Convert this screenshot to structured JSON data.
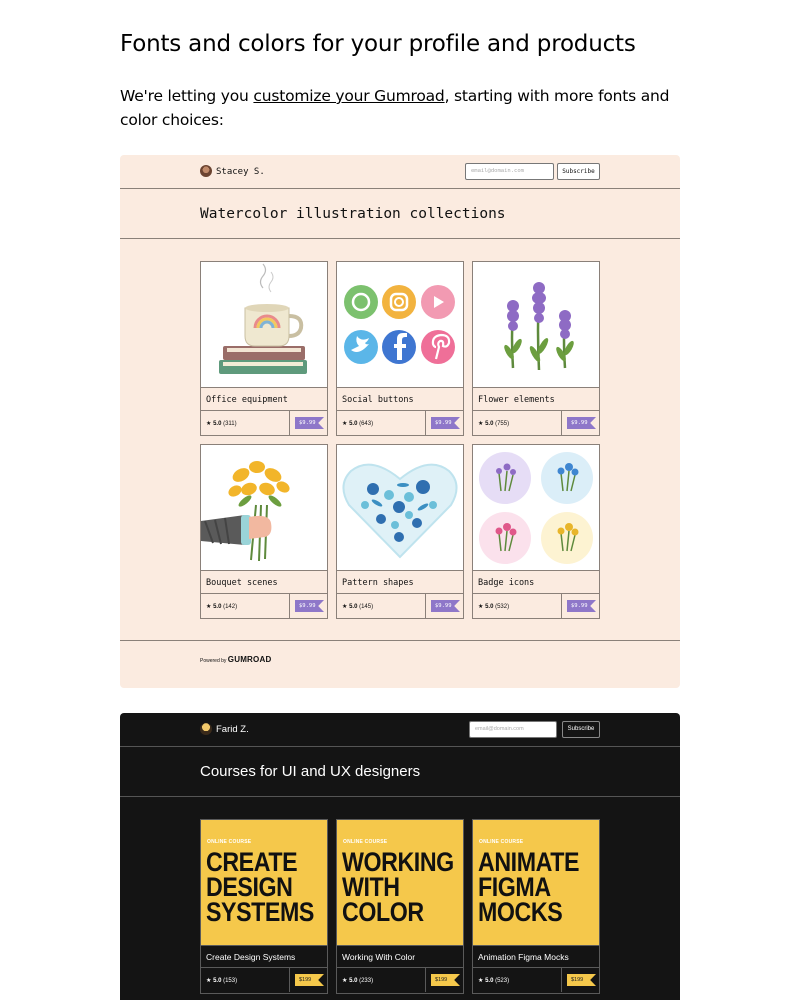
{
  "article": {
    "title": "Fonts and colors for your profile and products",
    "intro_before": "We're letting you ",
    "intro_link": "customize your Gumroad",
    "intro_after": ", starting with more fonts and color choices:"
  },
  "light_profile": {
    "creator_name": "Stacey S.",
    "email_placeholder": "email@domain.com",
    "subscribe_label": "Subscribe",
    "page_title": "Watercolor illustration collections",
    "products": [
      {
        "name": "Office equipment",
        "rating": "5.0",
        "count": "(311)",
        "price": "$9.99",
        "icon": "coffee-cup-books-icon"
      },
      {
        "name": "Social buttons",
        "rating": "5.0",
        "count": "(643)",
        "price": "$9.99",
        "icon": "social-buttons-icon"
      },
      {
        "name": "Flower elements",
        "rating": "5.0",
        "count": "(755)",
        "price": "$9.99",
        "icon": "lavender-icon"
      },
      {
        "name": "Bouquet scenes",
        "rating": "5.0",
        "count": "(142)",
        "price": "$9.99",
        "icon": "bouquet-icon"
      },
      {
        "name": "Pattern shapes",
        "rating": "5.0",
        "count": "(145)",
        "price": "$9.99",
        "icon": "floral-heart-icon"
      },
      {
        "name": "Badge icons",
        "rating": "5.0",
        "count": "(532)",
        "price": "$9.99",
        "icon": "flower-badges-icon"
      }
    ],
    "powered_by": "Powered by",
    "brand": "GUMROAD",
    "colors": {
      "background": "#fbebe0",
      "price_tag": "#8e77c9"
    }
  },
  "dark_profile": {
    "creator_name": "Farid Z.",
    "email_placeholder": "email@domain.com",
    "subscribe_label": "Subscribe",
    "page_title": "Courses for UI and UX designers",
    "course_label": "ONLINE COURSE",
    "products": [
      {
        "cover": "CREATE DESIGN SYSTEMS",
        "cover_lines": [
          "CREATE",
          "DESIGN",
          "SYSTEMS"
        ],
        "name": "Create Design Systems",
        "rating": "5.0",
        "count": "(153)",
        "price": "$199"
      },
      {
        "cover": "WORKING WITH COLOR",
        "cover_lines": [
          "WORKING",
          "WITH",
          "COLOR"
        ],
        "name": "Working With Color",
        "rating": "5.0",
        "count": "(233)",
        "price": "$199"
      },
      {
        "cover": "ANIMATE FIGMA MOCKS",
        "cover_lines": [
          "ANIMATE",
          "FIGMA",
          "MOCKS"
        ],
        "name": "Animation Figma Mocks",
        "rating": "5.0",
        "count": "(523)",
        "price": "$199"
      }
    ],
    "colors": {
      "background": "#141414",
      "cover": "#f5c84b"
    }
  }
}
